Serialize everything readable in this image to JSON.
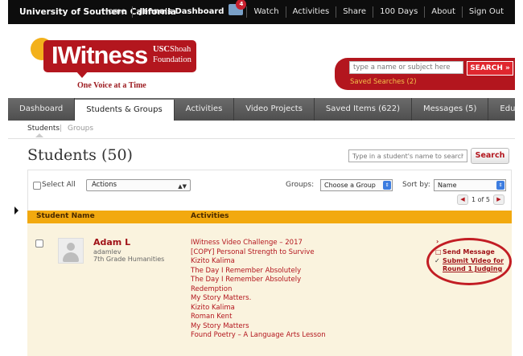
{
  "topnav": {
    "university": "University of Southern California",
    "links": [
      "Home",
      "Jenna's Dashboard",
      "Watch",
      "Activities",
      "Share",
      "100 Days",
      "About",
      "Sign Out"
    ],
    "notification_count": "4"
  },
  "header": {
    "logo_text": "IWitness",
    "usc_line1": "USC",
    "usc_line1b": "Shoah",
    "usc_line2": "Foundation",
    "tagline": "One Voice at a Time",
    "search_placeholder": "type a name or subject here",
    "search_button": "SEARCH »",
    "saved_searches": "Saved Searches (2)"
  },
  "mainnav": {
    "tabs": [
      "Dashboard",
      "Students & Groups",
      "Activities",
      "Video Projects",
      "Saved Items (622)",
      "Messages (5)",
      "Educators"
    ],
    "active": "Students & Groups"
  },
  "subnav": {
    "students": "Students",
    "separator": "|",
    "groups": "Groups"
  },
  "students": {
    "title": "Students (50)",
    "search_placeholder": "Type in a student's name to search",
    "search_button": "Search"
  },
  "toolbar": {
    "select_all": "Select All",
    "actions_value": "Actions",
    "groups_label": "Groups:",
    "groups_value": "Choose a Group",
    "sortby_label": "Sort by:",
    "sortby_value": "Name",
    "page": "1 of 5"
  },
  "table": {
    "col_student": "Student Name",
    "col_activities": "Activities",
    "rows": [
      {
        "name": "Adam L",
        "username": "adamlev",
        "class": "7th Grade Humanities",
        "activities": [
          "IWitness Video Challenge – 2017",
          "[COPY] Personal Strength to Survive",
          "Kizito Kalima",
          "The Day I Remember Absolutely",
          "The Day I Remember Absolutely",
          "Redemption",
          "My Story Matters.",
          "Kizito Kalima",
          "Roman Kent",
          "My Story Matters",
          "Found Poetry – A Language Arts Lesson"
        ],
        "options": {
          "send_message": "Send Message",
          "submit_line1": "Submit Video for",
          "submit_line2": "Round 1 Judging"
        }
      }
    ]
  }
}
